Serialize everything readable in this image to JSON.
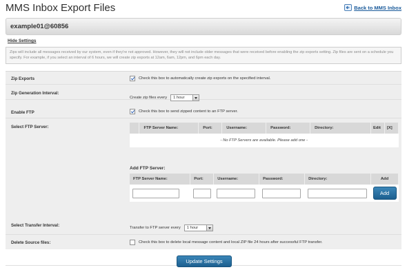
{
  "header": {
    "title": "MMS Inbox Export Files",
    "back_link": "Back to MMS Inbox"
  },
  "account": {
    "name": "example01@60856"
  },
  "hide_settings": "Hide Settings",
  "info": {
    "text": "Zips will include all messages received by our system, even if they're not approved. However, they will not include older messages that were received before enabling the zip exports setting. Zip files are sent on a schedule you specify. For example, if you select an interval of 6 hours, we will create zip exports at 12am, 6am, 12pm, and 6pm each day."
  },
  "settings": {
    "zip_exports": {
      "label": "Zip Exports",
      "checked": true,
      "description": "Check this box to automatically create zip exports on the specified interval."
    },
    "zip_interval": {
      "label": "Zip Generation Interval:",
      "prefix": "Create zip files every",
      "value": "1 hour"
    },
    "enable_ftp": {
      "label": "Enable FTP",
      "checked": true,
      "description": "Check this box to send zipped content to an FTP server."
    },
    "select_ftp": {
      "label": "Select FTP Server:",
      "columns": [
        "FTP Server Name:",
        "Port:",
        "Username:",
        "Password:",
        "Directory:",
        "Edit",
        "[X]"
      ],
      "empty_message": "- No FTP Servers are available. Please add one -"
    },
    "add_ftp": {
      "title": "Add FTP Server:",
      "columns": [
        "FTP Server Name:",
        "Port:",
        "Username:",
        "Password:",
        "Directory:",
        "Add"
      ],
      "add_button": "Add"
    },
    "transfer_interval": {
      "label": "Select Transfer Interval:",
      "prefix": "Transfer to FTP server every",
      "value": "1 hour"
    },
    "delete_source": {
      "label": "Delete Source files:",
      "checked": false,
      "description": "Check this box to delete local message content and local ZIP file 24 hours after successful FTP transfer."
    }
  },
  "update_button": "Update Settings",
  "colors": {
    "link": "#1a5a9a",
    "button": "#2a72a4",
    "panel": "#eeeeee"
  }
}
